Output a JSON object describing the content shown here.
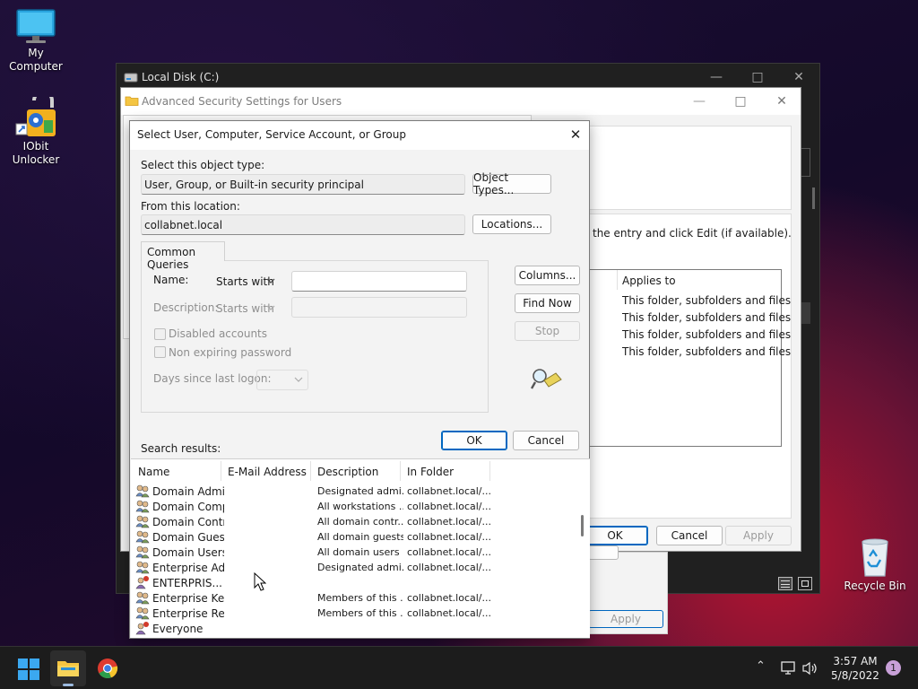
{
  "desktop": {
    "my_computer": "My Computer",
    "iobit": "IObit Unlocker",
    "recycle_bin": "Recycle Bin"
  },
  "explorer": {
    "title": "Local Disk (C:)"
  },
  "adv_security": {
    "title": "Advanced Security Settings for Users",
    "instruction": "the entry and click Edit (if available).",
    "applies_header": "Applies to",
    "applies": [
      "This folder, subfolders and files",
      "This folder, subfolders and files",
      "This folder, subfolders and files",
      "This folder, subfolders and files"
    ],
    "ok": "OK",
    "cancel": "Cancel",
    "apply": "Apply",
    "apply_behind": "Apply"
  },
  "dialog": {
    "title": "Select User, Computer, Service Account, or Group",
    "object_type_label": "Select this object type:",
    "object_type_value": "User, Group, or Built-in security principal",
    "object_types_btn": "Object Types...",
    "location_label": "From this location:",
    "location_value": "collabnet.local",
    "locations_btn": "Locations...",
    "tab_common_queries": "Common Queries",
    "name_label": "Name:",
    "name_mode": "Starts with",
    "name_value": "",
    "description_label": "Description:",
    "description_mode": "Starts with",
    "description_value": "",
    "disabled_accounts": "Disabled accounts",
    "non_expiring_password": "Non expiring password",
    "days_since_logon": "Days since last logon:",
    "columns_btn": "Columns...",
    "find_now_btn": "Find Now",
    "stop_btn": "Stop",
    "ok_btn": "OK",
    "cancel_btn": "Cancel",
    "search_results_label": "Search results:",
    "columns": [
      "Name",
      "E-Mail Address",
      "Description",
      "In Folder"
    ],
    "rows": [
      {
        "name": "Domain Admins",
        "email": "",
        "description": "Designated admi...",
        "folder": "collabnet.local/...",
        "icon": "group"
      },
      {
        "name": "Domain Comp...",
        "email": "",
        "description": "All workstations ...",
        "folder": "collabnet.local/...",
        "icon": "group"
      },
      {
        "name": "Domain Contr...",
        "email": "",
        "description": "All domain contr...",
        "folder": "collabnet.local/...",
        "icon": "group"
      },
      {
        "name": "Domain Guests",
        "email": "",
        "description": "All domain guests",
        "folder": "collabnet.local/...",
        "icon": "group"
      },
      {
        "name": "Domain Users",
        "email": "",
        "description": "All domain users",
        "folder": "collabnet.local/...",
        "icon": "group"
      },
      {
        "name": "Enterprise Ad...",
        "email": "",
        "description": "Designated admi...",
        "folder": "collabnet.local/...",
        "icon": "group"
      },
      {
        "name": "ENTERPRIS...",
        "email": "",
        "description": "",
        "folder": "",
        "icon": "special"
      },
      {
        "name": "Enterprise Ke...",
        "email": "",
        "description": "Members of this ...",
        "folder": "collabnet.local/...",
        "icon": "group"
      },
      {
        "name": "Enterprise Re...",
        "email": "",
        "description": "Members of this ...",
        "folder": "collabnet.local/...",
        "icon": "group"
      },
      {
        "name": "Everyone",
        "email": "",
        "description": "",
        "folder": "",
        "icon": "special"
      }
    ]
  },
  "taskbar": {
    "time": "3:57 AM",
    "date": "5/8/2022",
    "notification_count": "1"
  },
  "colors": {
    "accent": "#0067c0",
    "taskbar": "#1c1c1c"
  }
}
